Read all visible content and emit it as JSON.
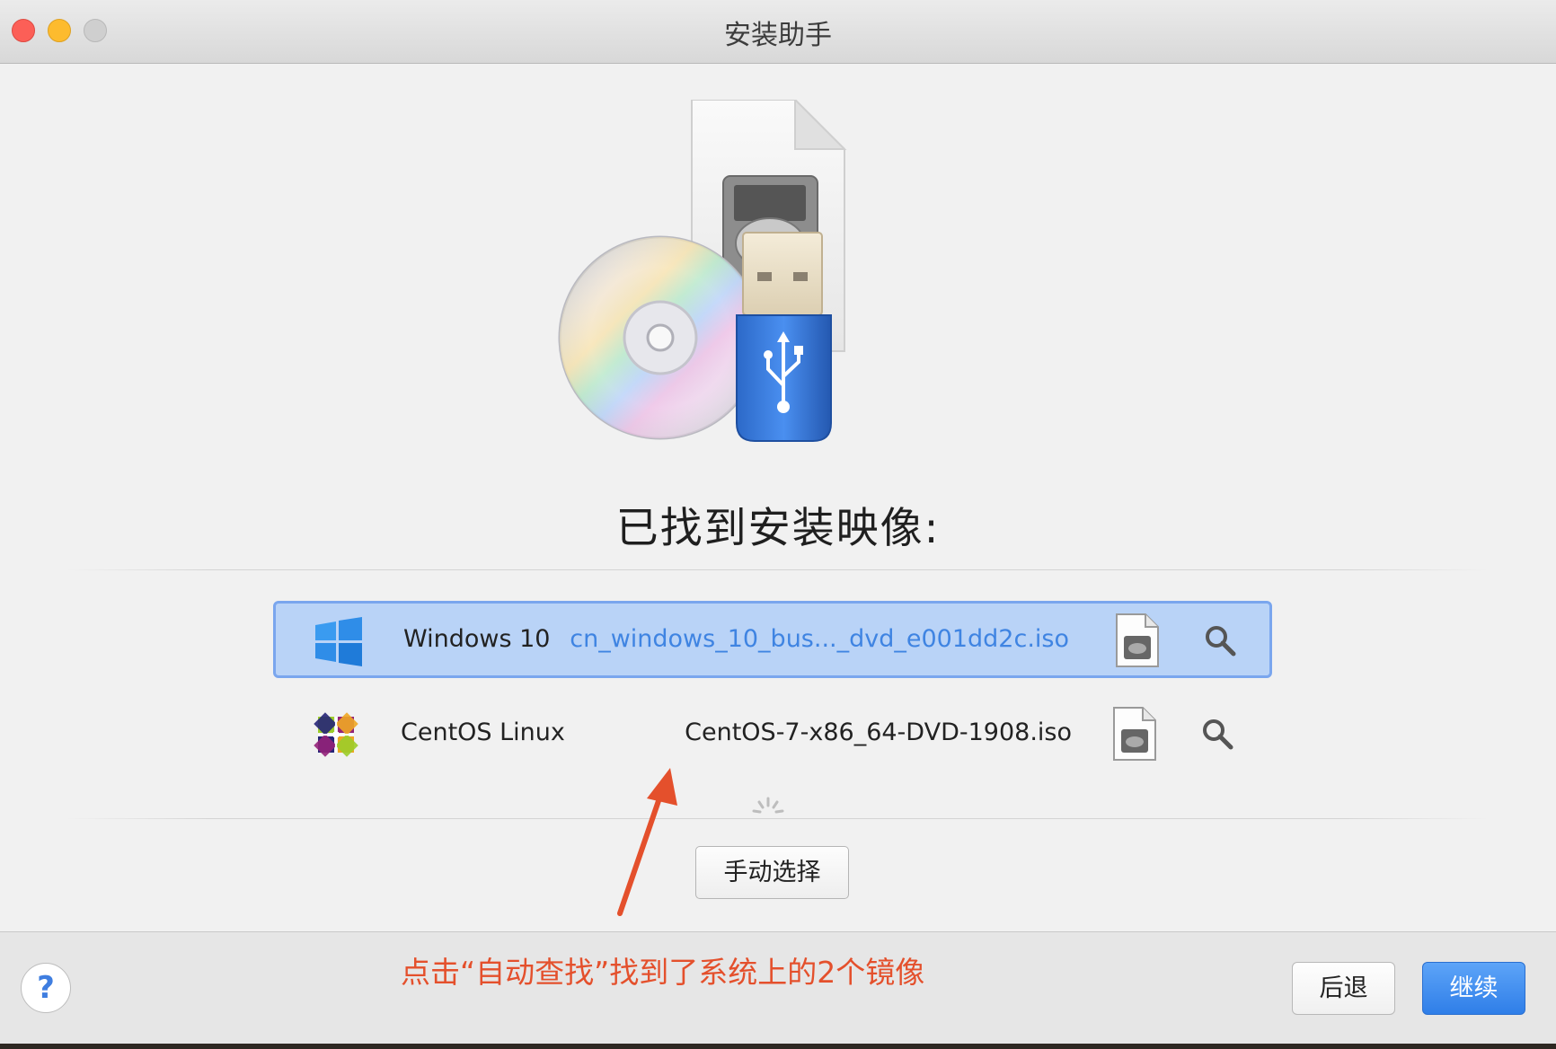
{
  "window": {
    "title": "安装助手"
  },
  "main": {
    "heading": "已找到安装映像:",
    "images": [
      {
        "os": "Windows 10",
        "file": "cn_windows_10_bus..._dvd_e001dd2c.iso",
        "selected": true,
        "os_icon": "windows-logo-icon"
      },
      {
        "os": "CentOS Linux",
        "file": "CentOS-7-x86_64-DVD-1908.iso",
        "selected": false,
        "os_icon": "centos-logo-icon"
      }
    ],
    "manual_button": "手动选择"
  },
  "footer": {
    "help_label": "?",
    "annotation": "点击“自动查找”找到了系统上的2个镜像",
    "back_label": "后退",
    "continue_label": "继续"
  },
  "colors": {
    "accent": "#3f84e2",
    "selection_bg": "#b9d3f7",
    "annotation": "#e4502c"
  }
}
